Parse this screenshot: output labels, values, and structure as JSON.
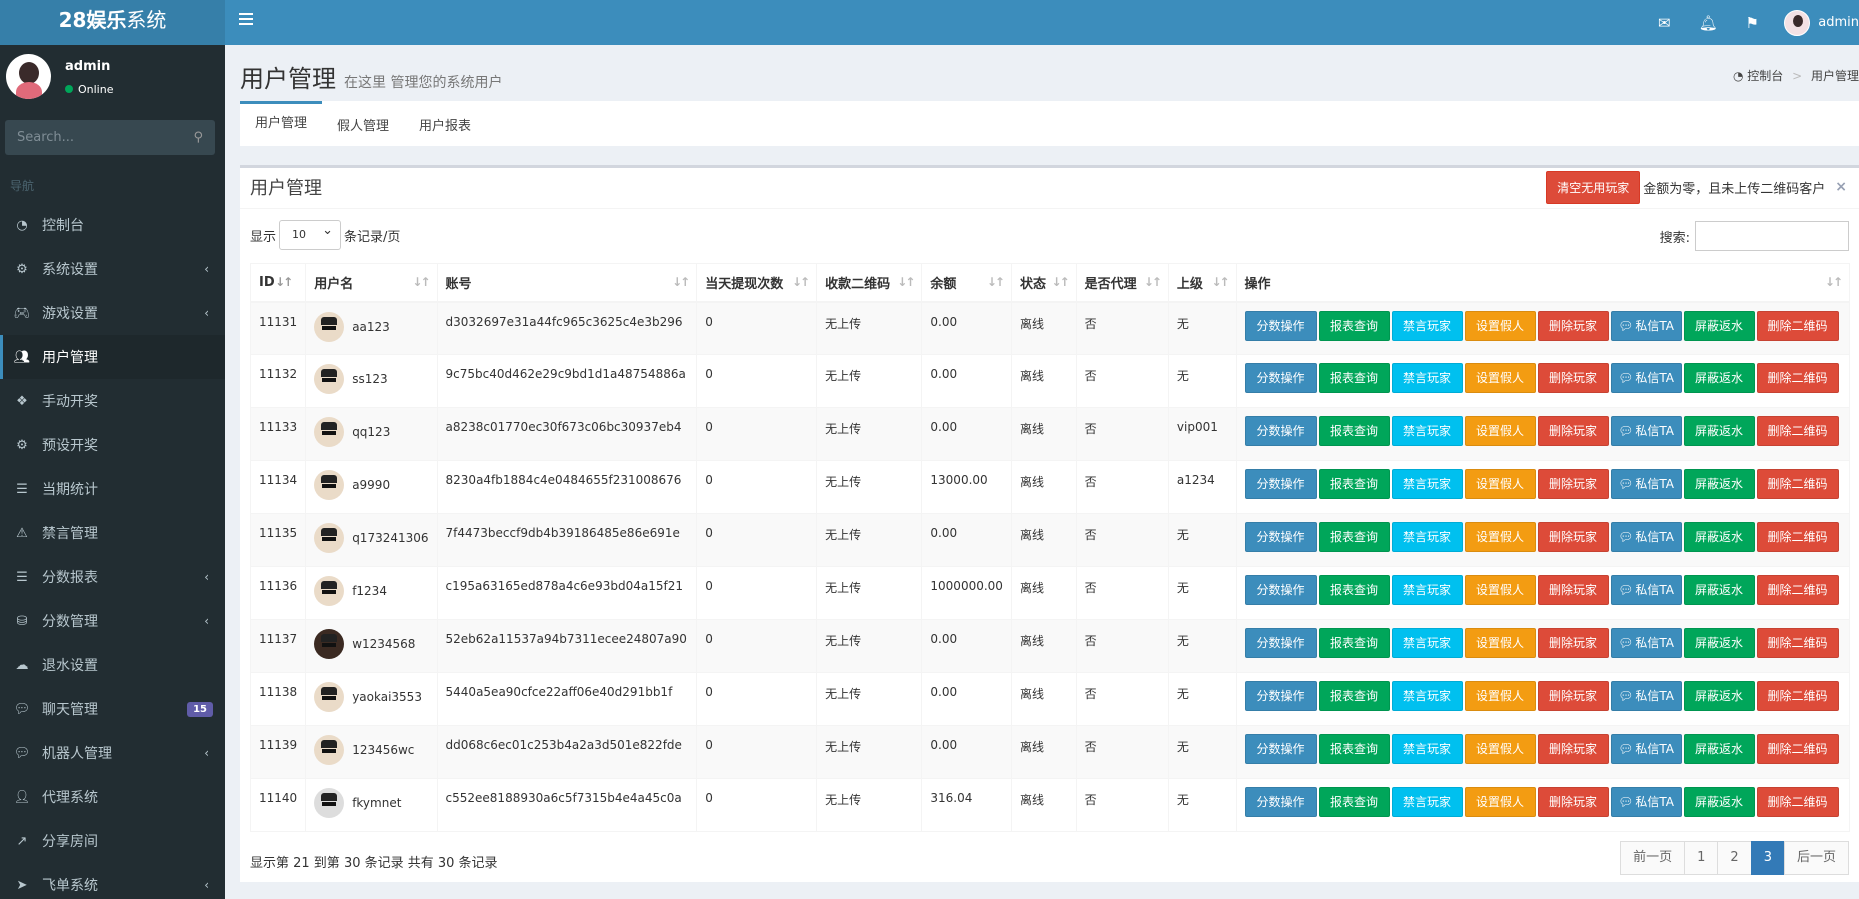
{
  "app": {
    "logo_bold": "28娱乐",
    "logo_rest": "系统",
    "user": "admin"
  },
  "sidebar": {
    "user_name": "admin",
    "status": "Online",
    "search_placeholder": "Search...",
    "header": "导航",
    "items": [
      {
        "label": "控制台",
        "icon": "dashboard-icon",
        "arrow": false
      },
      {
        "label": "系统设置",
        "icon": "cogs-icon",
        "arrow": true
      },
      {
        "label": "游戏设置",
        "icon": "gamepad-icon",
        "arrow": true
      },
      {
        "label": "用户管理",
        "icon": "users-icon",
        "arrow": false,
        "active": true
      },
      {
        "label": "手动开奖",
        "icon": "cubes-icon",
        "arrow": false
      },
      {
        "label": "预设开奖",
        "icon": "gear-icon",
        "arrow": false
      },
      {
        "label": "当期统计",
        "icon": "list-icon",
        "arrow": false
      },
      {
        "label": "禁言管理",
        "icon": "warning-icon",
        "arrow": false
      },
      {
        "label": "分数报表",
        "icon": "list-ul-icon",
        "arrow": true
      },
      {
        "label": "分数管理",
        "icon": "database-icon",
        "arrow": true
      },
      {
        "label": "退水设置",
        "icon": "cloud-upload-icon",
        "arrow": false
      },
      {
        "label": "聊天管理",
        "icon": "comments-icon",
        "badge": "15"
      },
      {
        "label": "机器人管理",
        "icon": "comment-icon",
        "arrow": true
      },
      {
        "label": "代理系统",
        "icon": "user-plus-icon",
        "arrow": false
      },
      {
        "label": "分享房间",
        "icon": "share-icon",
        "arrow": false
      },
      {
        "label": "飞单系统",
        "icon": "send-icon",
        "arrow": true
      }
    ]
  },
  "header": {
    "title": "用户管理",
    "subtitle": "在这里 管理您的系统用户",
    "breadcrumb_home": "控制台",
    "breadcrumb_current": "用户管理"
  },
  "tabs": [
    "用户管理",
    "假人管理",
    "用户报表"
  ],
  "box": {
    "title": "用户管理",
    "clear_button": "清空无用玩家",
    "alert_text": "金额为零，且未上传二维码客户",
    "show_prefix": "显示",
    "page_size": "10",
    "show_suffix": "条记录/页",
    "search_label": "搜索:"
  },
  "table": {
    "columns": [
      "ID",
      "用户名",
      "账号",
      "当天提现次数",
      "收款二维码",
      "余额",
      "状态",
      "是否代理",
      "上级",
      "操作"
    ],
    "actions": [
      "分数操作",
      "报表查询",
      "禁言玩家",
      "设置假人",
      "删除玩家",
      "私信TA",
      "屏蔽返水",
      "删除二维码"
    ],
    "rows": [
      {
        "id": "11131",
        "username": "aa123",
        "account": "d3032697e31a44fc965c3625c4e3b296",
        "withdraw": "0",
        "qr": "无上传",
        "balance": "0.00",
        "status": "离线",
        "agent": "否",
        "parent": "无",
        "avatar": "cool"
      },
      {
        "id": "11132",
        "username": "ss123",
        "account": "9c75bc40d462e29c9bd1d1a48754886a",
        "withdraw": "0",
        "qr": "无上传",
        "balance": "0.00",
        "status": "离线",
        "agent": "否",
        "parent": "无",
        "avatar": "cool"
      },
      {
        "id": "11133",
        "username": "qq123",
        "account": "a8238c01770ec30f673c06bc30937eb4",
        "withdraw": "0",
        "qr": "无上传",
        "balance": "0.00",
        "status": "离线",
        "agent": "否",
        "parent": "vip001",
        "avatar": "cool"
      },
      {
        "id": "11134",
        "username": "a9990",
        "account": "8230a4fb1884c4e0484655f231008676",
        "withdraw": "0",
        "qr": "无上传",
        "balance": "13000.00",
        "status": "离线",
        "agent": "否",
        "parent": "a1234",
        "avatar": "cool"
      },
      {
        "id": "11135",
        "username": "q173241306",
        "account": "7f4473beccf9db4b39186485e86e691e",
        "withdraw": "0",
        "qr": "无上传",
        "balance": "0.00",
        "status": "离线",
        "agent": "否",
        "parent": "无",
        "avatar": "cool"
      },
      {
        "id": "11136",
        "username": "f1234",
        "account": "c195a63165ed878a4c6e93bd04a15f21",
        "withdraw": "0",
        "qr": "无上传",
        "balance": "1000000.00",
        "status": "离线",
        "agent": "否",
        "parent": "无",
        "avatar": "cool"
      },
      {
        "id": "11137",
        "username": "w1234568",
        "account": "52eb62a11537a94b7311ecee24807a90",
        "withdraw": "0",
        "qr": "无上传",
        "balance": "0.00",
        "status": "离线",
        "agent": "否",
        "parent": "无",
        "avatar": "dark"
      },
      {
        "id": "11138",
        "username": "yaokai3553",
        "account": "5440a5ea90cfce22aff06e40d291bb1f",
        "withdraw": "0",
        "qr": "无上传",
        "balance": "0.00",
        "status": "离线",
        "agent": "否",
        "parent": "无",
        "avatar": "cool"
      },
      {
        "id": "11139",
        "username": "123456wc",
        "account": "dd068c6ec01c253b4a2a3d501e822fde",
        "withdraw": "0",
        "qr": "无上传",
        "balance": "0.00",
        "status": "离线",
        "agent": "否",
        "parent": "无",
        "avatar": "cool"
      },
      {
        "id": "11140",
        "username": "fkymnet",
        "account": "c552ee8188930a6c5f7315b4e4a45c0a",
        "withdraw": "0",
        "qr": "无上传",
        "balance": "316.04",
        "status": "离线",
        "agent": "否",
        "parent": "无",
        "avatar": "white"
      }
    ]
  },
  "footer": {
    "info": "显示第 21 到第 30 条记录 共有 30 条记录",
    "prev": "前一页",
    "pages": [
      "1",
      "2",
      "3"
    ],
    "current_page": "3",
    "next": "后一页"
  }
}
